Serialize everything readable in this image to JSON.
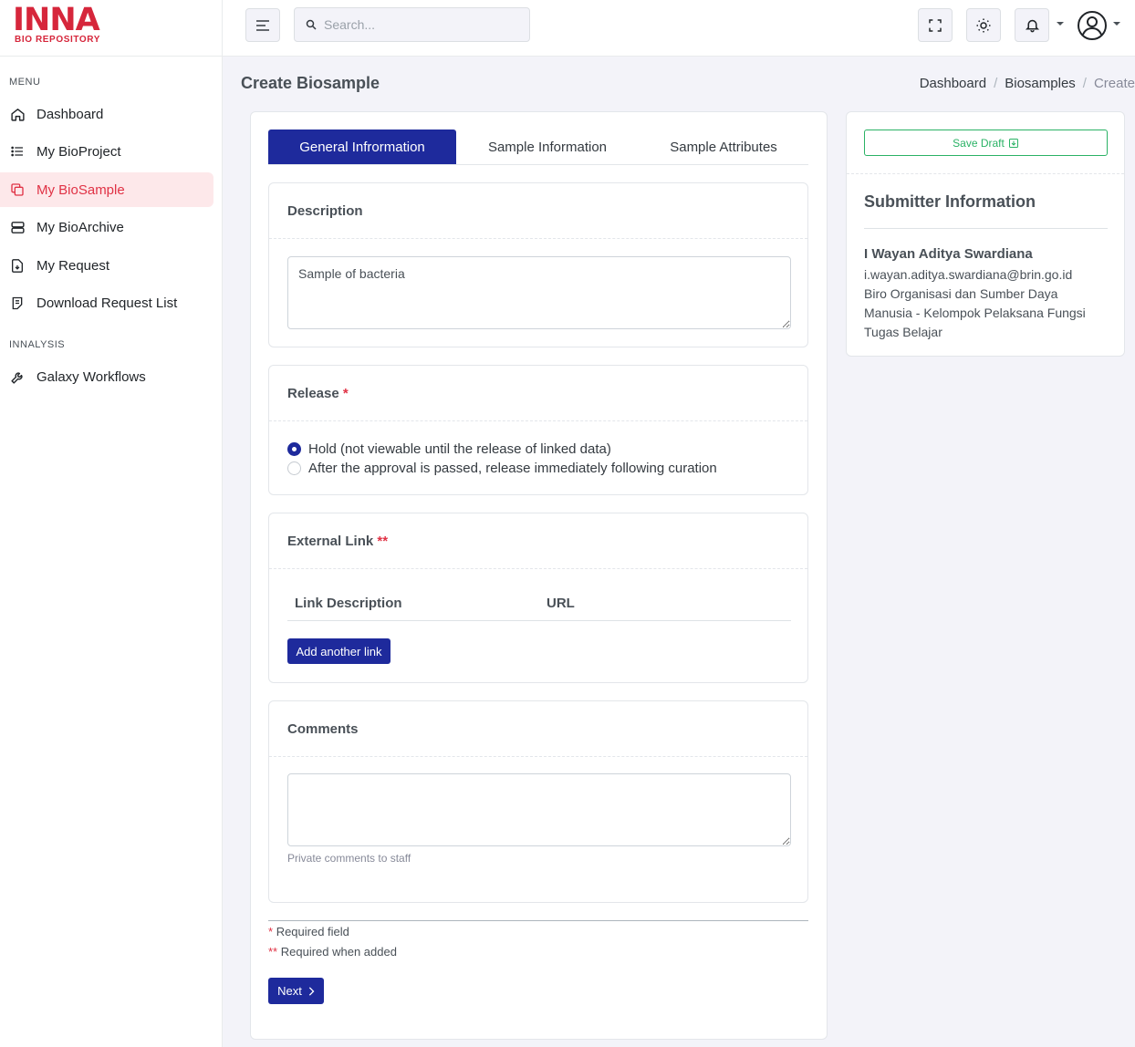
{
  "brand": {
    "name": "INNA",
    "sub": "BIO REPOSITORY",
    "color": "#d6263b"
  },
  "sidebar": {
    "menu_title": "MENU",
    "items": [
      {
        "label": "Dashboard",
        "icon": "home-icon"
      },
      {
        "label": "My BioProject",
        "icon": "list-icon"
      },
      {
        "label": "My BioSample",
        "icon": "copy-icon",
        "active": true
      },
      {
        "label": "My BioArchive",
        "icon": "server-icon"
      },
      {
        "label": "My Request",
        "icon": "file-download-icon"
      },
      {
        "label": "Download Request List",
        "icon": "file-list-icon"
      }
    ],
    "section2_title": "INNALYSIS",
    "items2": [
      {
        "label": "Galaxy Workflows",
        "icon": "tools-icon"
      }
    ]
  },
  "topbar": {
    "search_placeholder": "Search..."
  },
  "page": {
    "title": "Create Biosample",
    "breadcrumb": [
      "Dashboard",
      "Biosamples",
      "Create"
    ]
  },
  "tabs": [
    "General Infrormation",
    "Sample Information",
    "Sample Attributes"
  ],
  "form": {
    "description": {
      "label": "Description",
      "value": "Sample of bacteria"
    },
    "release": {
      "label": "Release",
      "required_mark": "*",
      "options": [
        {
          "label": "Hold (not viewable until the release of linked data)",
          "selected": true
        },
        {
          "label": "After the approval is passed, release immediately following curation",
          "selected": false
        }
      ]
    },
    "external_link": {
      "label": "External Link",
      "required_mark": "**",
      "columns": [
        "Link Description",
        "URL"
      ],
      "add_button": "Add another link"
    },
    "comments": {
      "label": "Comments",
      "value": "",
      "help": "Private comments to staff"
    },
    "notes": {
      "required_mark": "*",
      "required": "Required field",
      "required_added_mark": "**",
      "required_added": "Required when added"
    },
    "next_button": "Next"
  },
  "side": {
    "save_draft": "Save Draft",
    "submitter_title": "Submitter Information",
    "name": "I Wayan Aditya Swardiana",
    "email": "i.wayan.aditya.swardiana@brin.go.id",
    "org_line1": "Biro Organisasi dan Sumber Daya",
    "org_line2": "Manusia - Kelompok Pelaksana Fungsi",
    "org_line3": "Tugas Belajar"
  },
  "colors": {
    "primary": "#1e2a9c",
    "danger": "#e03245",
    "success": "#2ab265"
  }
}
